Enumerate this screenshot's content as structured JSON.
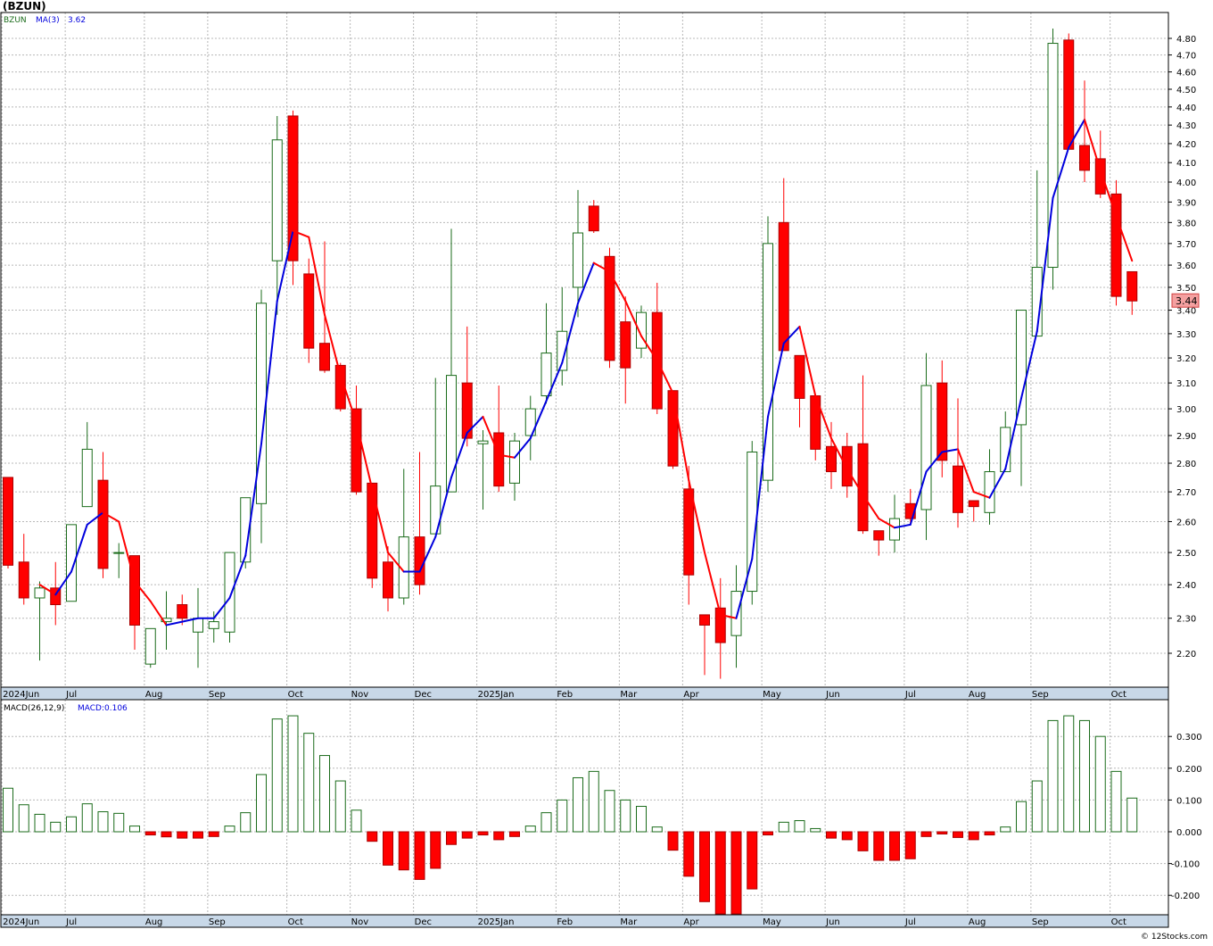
{
  "header": {
    "ticker_title": "(BZUN)"
  },
  "legend_top": {
    "symbol": "BZUN",
    "ma_label": "MA(3)",
    "ma_value": "3.62"
  },
  "legend_bottom": {
    "macd_params": "MACD(26,12,9)",
    "macd_value": "MACD:0.106"
  },
  "last_price_label": "3.44",
  "footer": {
    "credit": "© 12Stocks.com"
  },
  "colors": {
    "up": "#1a6b1a",
    "down": "#ff0000",
    "ma_up": "#0000dd",
    "ma_down": "#ff0000",
    "grid": "#b8b8b8",
    "axis_band": "#c8d8e8"
  },
  "chart_data": [
    {
      "type": "candlestick",
      "title": "(BZUN)",
      "period": "weekly",
      "y_ticks": [
        2.2,
        2.3,
        2.4,
        2.5,
        2.6,
        2.7,
        2.8,
        2.9,
        3.0,
        3.1,
        3.2,
        3.3,
        3.4,
        3.5,
        3.6,
        3.7,
        3.8,
        3.9,
        4.0,
        4.1,
        4.2,
        4.3,
        4.4,
        4.5,
        4.6,
        4.7,
        4.8
      ],
      "y_scale": "log",
      "month_labels": [
        "2024Jun",
        "Jul",
        "Aug",
        "Sep",
        "Oct",
        "Nov",
        "Dec",
        "2025Jan",
        "Feb",
        "Mar",
        "Apr",
        "May",
        "Jun",
        "Jul",
        "Aug",
        "Sep",
        "Oct"
      ],
      "month_start_week": [
        0,
        4,
        9,
        13,
        18,
        22,
        26,
        30,
        35,
        39,
        43,
        48,
        52,
        57,
        61,
        65,
        70
      ],
      "grid": true,
      "series": [
        {
          "name": "BZUN",
          "ohlc": [
            [
              2.75,
              2.75,
              2.45,
              2.46
            ],
            [
              2.47,
              2.56,
              2.34,
              2.36
            ],
            [
              2.36,
              2.41,
              2.18,
              2.39
            ],
            [
              2.39,
              2.47,
              2.28,
              2.34
            ],
            [
              2.35,
              2.59,
              2.35,
              2.59
            ],
            [
              2.65,
              2.95,
              2.65,
              2.85
            ],
            [
              2.74,
              2.84,
              2.42,
              2.45
            ],
            [
              2.5,
              2.53,
              2.42,
              2.5
            ],
            [
              2.49,
              2.49,
              2.21,
              2.28
            ],
            [
              2.17,
              2.27,
              2.16,
              2.27
            ],
            [
              2.29,
              2.38,
              2.21,
              2.3
            ],
            [
              2.34,
              2.37,
              2.28,
              2.3
            ],
            [
              2.26,
              2.39,
              2.16,
              2.3
            ],
            [
              2.27,
              2.32,
              2.23,
              2.29
            ],
            [
              2.26,
              2.5,
              2.23,
              2.5
            ],
            [
              2.47,
              2.68,
              2.45,
              2.68
            ],
            [
              2.66,
              3.49,
              2.53,
              3.43
            ],
            [
              3.62,
              4.35,
              3.38,
              4.22
            ],
            [
              4.35,
              4.38,
              3.51,
              3.62
            ],
            [
              3.56,
              3.63,
              3.18,
              3.24
            ],
            [
              3.26,
              3.71,
              3.14,
              3.15
            ],
            [
              3.17,
              3.18,
              2.99,
              3.0
            ],
            [
              3.0,
              3.09,
              2.69,
              2.7
            ],
            [
              2.73,
              2.73,
              2.39,
              2.42
            ],
            [
              2.47,
              2.52,
              2.32,
              2.36
            ],
            [
              2.36,
              2.78,
              2.34,
              2.55
            ],
            [
              2.55,
              2.84,
              2.37,
              2.4
            ],
            [
              2.56,
              3.12,
              2.56,
              2.72
            ],
            [
              2.7,
              3.77,
              2.7,
              3.13
            ],
            [
              3.1,
              3.33,
              2.86,
              2.89
            ],
            [
              2.87,
              2.92,
              2.64,
              2.88
            ],
            [
              2.91,
              3.09,
              2.7,
              2.72
            ],
            [
              2.73,
              2.91,
              2.67,
              2.88
            ],
            [
              2.9,
              3.05,
              2.81,
              3.0
            ],
            [
              3.05,
              3.43,
              3.02,
              3.22
            ],
            [
              3.15,
              3.5,
              3.09,
              3.31
            ],
            [
              3.5,
              3.96,
              3.37,
              3.75
            ],
            [
              3.88,
              3.91,
              3.75,
              3.76
            ],
            [
              3.64,
              3.68,
              3.16,
              3.19
            ],
            [
              3.35,
              3.46,
              3.02,
              3.16
            ],
            [
              3.24,
              3.42,
              3.2,
              3.39
            ],
            [
              3.39,
              3.52,
              2.98,
              3.0
            ],
            [
              3.07,
              3.07,
              2.78,
              2.79
            ],
            [
              2.71,
              2.79,
              2.34,
              2.43
            ],
            [
              2.31,
              2.31,
              2.14,
              2.28
            ],
            [
              2.33,
              2.42,
              2.13,
              2.23
            ],
            [
              2.25,
              2.46,
              2.16,
              2.38
            ],
            [
              2.38,
              2.88,
              2.34,
              2.84
            ],
            [
              2.74,
              3.83,
              2.7,
              3.7
            ],
            [
              3.8,
              4.02,
              3.41,
              3.23
            ],
            [
              3.21,
              3.21,
              2.93,
              3.04
            ],
            [
              3.05,
              3.05,
              2.81,
              2.85
            ],
            [
              2.86,
              2.95,
              2.71,
              2.77
            ],
            [
              2.86,
              2.91,
              2.68,
              2.72
            ],
            [
              2.87,
              3.13,
              2.56,
              2.57
            ],
            [
              2.57,
              2.57,
              2.49,
              2.54
            ],
            [
              2.54,
              2.69,
              2.5,
              2.61
            ],
            [
              2.66,
              2.71,
              2.59,
              2.61
            ],
            [
              2.64,
              3.22,
              2.54,
              3.09
            ],
            [
              3.1,
              3.19,
              2.75,
              2.81
            ],
            [
              2.79,
              3.04,
              2.58,
              2.63
            ],
            [
              2.67,
              2.67,
              2.6,
              2.65
            ],
            [
              2.63,
              2.85,
              2.59,
              2.77
            ],
            [
              2.77,
              2.99,
              2.77,
              2.93
            ],
            [
              2.94,
              3.4,
              2.72,
              3.4
            ],
            [
              3.29,
              4.06,
              3.29,
              3.59
            ],
            [
              3.59,
              4.86,
              3.49,
              4.77
            ],
            [
              4.79,
              4.83,
              4.17,
              4.17
            ],
            [
              4.19,
              4.55,
              4.0,
              4.06
            ],
            [
              4.12,
              4.27,
              3.92,
              3.94
            ],
            [
              3.94,
              4.01,
              3.42,
              3.46
            ],
            [
              3.57,
              3.57,
              3.38,
              3.44
            ]
          ]
        },
        {
          "name": "MA(3)",
          "values": [
            null,
            null,
            2.4,
            2.37,
            2.44,
            2.59,
            2.63,
            2.6,
            2.41,
            2.35,
            2.28,
            2.29,
            2.3,
            2.3,
            2.36,
            2.49,
            2.87,
            3.44,
            3.76,
            3.73,
            3.38,
            3.13,
            2.95,
            2.71,
            2.5,
            2.44,
            2.44,
            2.55,
            2.75,
            2.91,
            2.97,
            2.83,
            2.82,
            2.89,
            3.03,
            3.18,
            3.43,
            3.61,
            3.57,
            3.44,
            3.29,
            3.19,
            3.06,
            2.74,
            2.5,
            2.31,
            2.3,
            2.48,
            2.97,
            3.26,
            3.33,
            3.05,
            2.89,
            2.78,
            2.69,
            2.61,
            2.58,
            2.59,
            2.77,
            2.84,
            2.85,
            2.7,
            2.68,
            2.78,
            3.04,
            3.31,
            3.92,
            4.18,
            4.33,
            4.06,
            3.83,
            3.62
          ]
        }
      ]
    },
    {
      "type": "bar",
      "title": "MACD(26,12,9)",
      "y_ticks": [
        -0.2,
        -0.1,
        0.0,
        0.1,
        0.2,
        0.3
      ],
      "ylim": [
        -0.26,
        0.38
      ],
      "month_labels": [
        "2024Jun",
        "Jul",
        "Aug",
        "Sep",
        "Oct",
        "Nov",
        "Dec",
        "2025Jan",
        "Feb",
        "Mar",
        "Apr",
        "May",
        "Jun",
        "Jul",
        "Aug",
        "Sep",
        "Oct"
      ],
      "series": [
        {
          "name": "MACD",
          "values": [
            0.137,
            0.085,
            0.055,
            0.03,
            0.047,
            0.088,
            0.063,
            0.058,
            0.018,
            -0.01,
            -0.016,
            -0.02,
            -0.02,
            -0.015,
            0.018,
            0.06,
            0.18,
            0.355,
            0.365,
            0.31,
            0.24,
            0.16,
            0.068,
            -0.03,
            -0.105,
            -0.12,
            -0.15,
            -0.115,
            -0.04,
            -0.02,
            -0.01,
            -0.025,
            -0.015,
            0.018,
            0.06,
            0.1,
            0.17,
            0.19,
            0.13,
            0.1,
            0.08,
            0.015,
            -0.058,
            -0.14,
            -0.22,
            -0.27,
            -0.26,
            -0.18,
            -0.01,
            0.03,
            0.035,
            0.01,
            -0.02,
            -0.025,
            -0.06,
            -0.09,
            -0.09,
            -0.085,
            -0.015,
            -0.007,
            -0.018,
            -0.025,
            -0.01,
            0.015,
            0.095,
            0.16,
            0.35,
            0.365,
            0.35,
            0.3,
            0.19,
            0.106
          ]
        }
      ]
    }
  ]
}
